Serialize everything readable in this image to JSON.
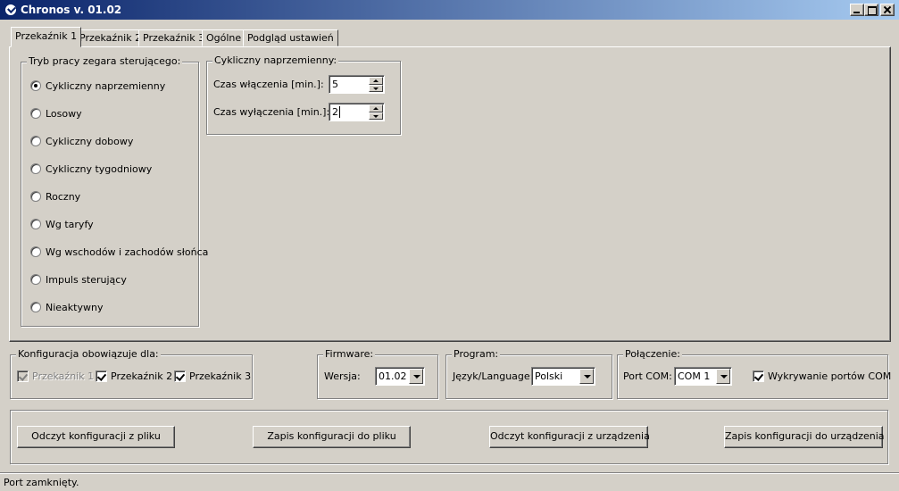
{
  "window": {
    "title": "Chronos v. 01.02"
  },
  "tabs": [
    {
      "label": "Przekaźnik 1",
      "active": true
    },
    {
      "label": "Przekaźnik 2",
      "active": false
    },
    {
      "label": "Przekaźnik 3",
      "active": false
    },
    {
      "label": "Ogólne",
      "active": false
    },
    {
      "label": "Podgląd ustawień",
      "active": false
    }
  ],
  "mode_group": {
    "label": "Tryb pracy zegara sterującego:",
    "options": [
      {
        "label": "Cykliczny naprzemienny",
        "checked": true
      },
      {
        "label": "Losowy",
        "checked": false
      },
      {
        "label": "Cykliczny dobowy",
        "checked": false
      },
      {
        "label": "Cykliczny tygodniowy",
        "checked": false
      },
      {
        "label": "Roczny",
        "checked": false
      },
      {
        "label": "Wg taryfy",
        "checked": false
      },
      {
        "label": "Wg wschodów i zachodów słońca",
        "checked": false
      },
      {
        "label": "Impuls sterujący",
        "checked": false
      },
      {
        "label": "Nieaktywny",
        "checked": false
      }
    ]
  },
  "cyclic_group": {
    "label": "Cykliczny naprzemienny:",
    "on_time": {
      "label": "Czas włączenia [min.]:",
      "value": "5"
    },
    "off_time": {
      "label": "Czas wyłączenia [min.]:",
      "value": "2"
    }
  },
  "config_group": {
    "label": "Konfiguracja obowiązuje dla:",
    "relays": [
      {
        "label": "Przekaźnik 1",
        "checked": true,
        "disabled": true
      },
      {
        "label": "Przekaźnik 2",
        "checked": true,
        "disabled": false
      },
      {
        "label": "Przekaźnik 3",
        "checked": true,
        "disabled": false
      }
    ]
  },
  "firmware_group": {
    "label": "Firmware:",
    "version_label": "Wersja:",
    "version_value": "01.02"
  },
  "program_group": {
    "label": "Program:",
    "language_label": "Język/Language:",
    "language_value": "Polski"
  },
  "connection_group": {
    "label": "Połączenie:",
    "port_label": "Port COM:",
    "port_value": "COM 1",
    "detect_label": "Wykrywanie portów COM",
    "detect_checked": true
  },
  "actions": {
    "read_file": "Odczyt konfiguracji z pliku",
    "save_file": "Zapis konfiguracji do pliku",
    "read_device": "Odczyt konfiguracji z urządzenia",
    "save_device": "Zapis konfiguracji do urządzenia"
  },
  "status": {
    "text": "Port zamknięty."
  }
}
